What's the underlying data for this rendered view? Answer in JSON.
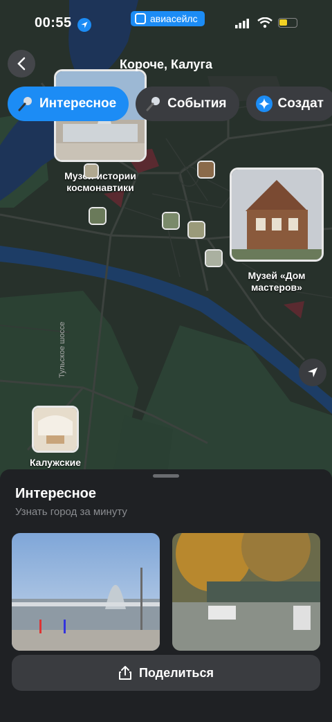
{
  "status_bar": {
    "time": "00:55",
    "app_name": "авиасейлс"
  },
  "header": {
    "back_icon": "chevron-left-icon",
    "title": "Короче, Калуга"
  },
  "chips": [
    {
      "label": "Интересное",
      "icon": "microphone-icon",
      "active": true
    },
    {
      "label": "События",
      "icon": "microphone-icon",
      "active": false
    },
    {
      "label": "Создат",
      "icon": "sparkle-icon",
      "active": false
    }
  ],
  "map": {
    "road_label": "Тульское шоссе",
    "pins": [
      {
        "label": "Музей истории космонавтики"
      },
      {
        "label": "Музей «Дом мастеров»"
      },
      {
        "label": "Калужские"
      }
    ]
  },
  "sheet": {
    "title": "Интересное",
    "subtitle": "Узнать город за минуту",
    "share_label": "Поделиться"
  },
  "colors": {
    "accent": "#1c8cf5",
    "map_bg": "#26302b",
    "sheet_bg": "#1f2124",
    "button_bg": "#3a3c40"
  }
}
